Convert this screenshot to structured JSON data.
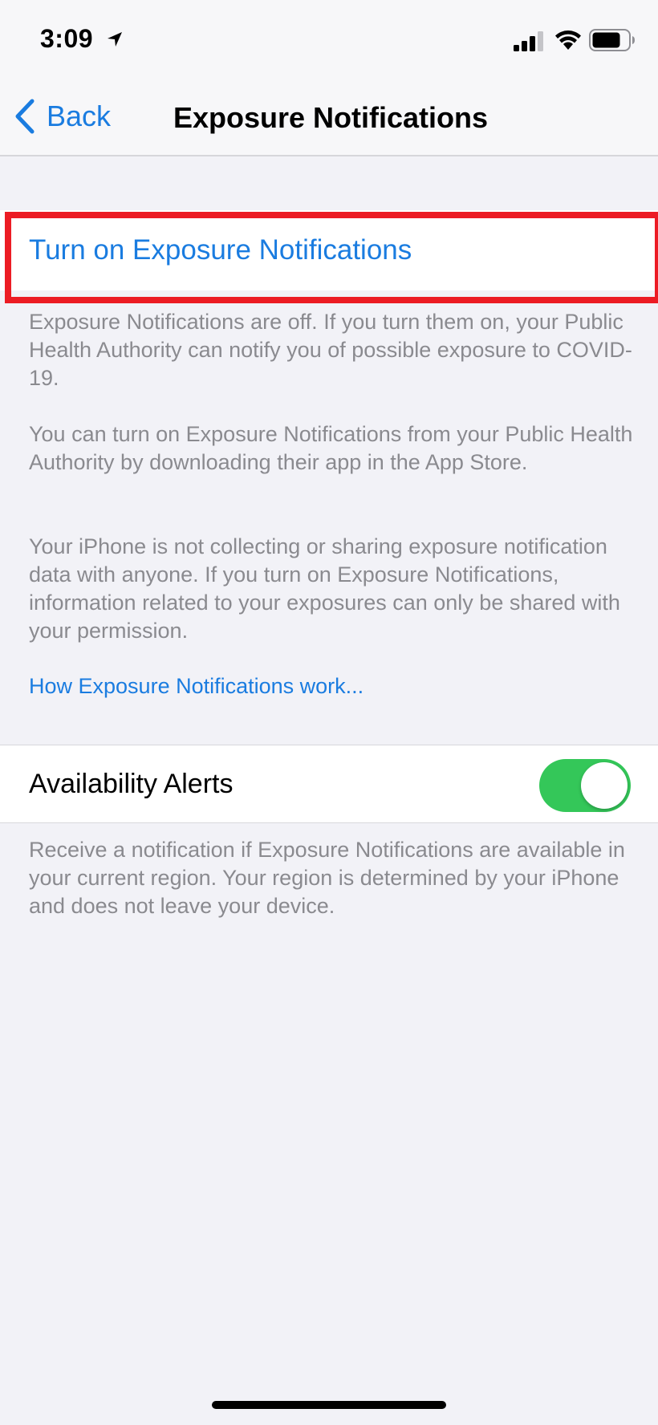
{
  "status_bar": {
    "time": "3:09",
    "icons": [
      "location-arrow-icon",
      "signal-icon",
      "wifi-icon",
      "battery-icon"
    ]
  },
  "nav": {
    "back_label": "Back",
    "title": "Exposure Notifications"
  },
  "turn_on": {
    "label": "Turn on Exposure Notifications"
  },
  "descriptions": {
    "off_notice": "Exposure Notifications are off. If you turn them on, your Public Health Authority can notify you of possible exposure to COVID-19.",
    "app_store_notice": "You can turn on Exposure Notifications from your Public Health Authority by downloading their app in the App Store.",
    "privacy_notice": "Your iPhone is not collecting or sharing exposure notification data with anyone. If you turn on Exposure Notifications, information related to your exposures can only be shared with your permission."
  },
  "how_link": "How Exposure Notifications work...",
  "availability_alerts": {
    "label": "Availability Alerts",
    "enabled": true,
    "description": "Receive a notification if Exposure Notifications are available in your current region. Your region is determined by your iPhone and does not leave your device."
  },
  "colors": {
    "accent": "#1a7ce0",
    "toggle_on": "#34c759",
    "highlight": "#ec1c24",
    "background": "#f2f2f7"
  }
}
